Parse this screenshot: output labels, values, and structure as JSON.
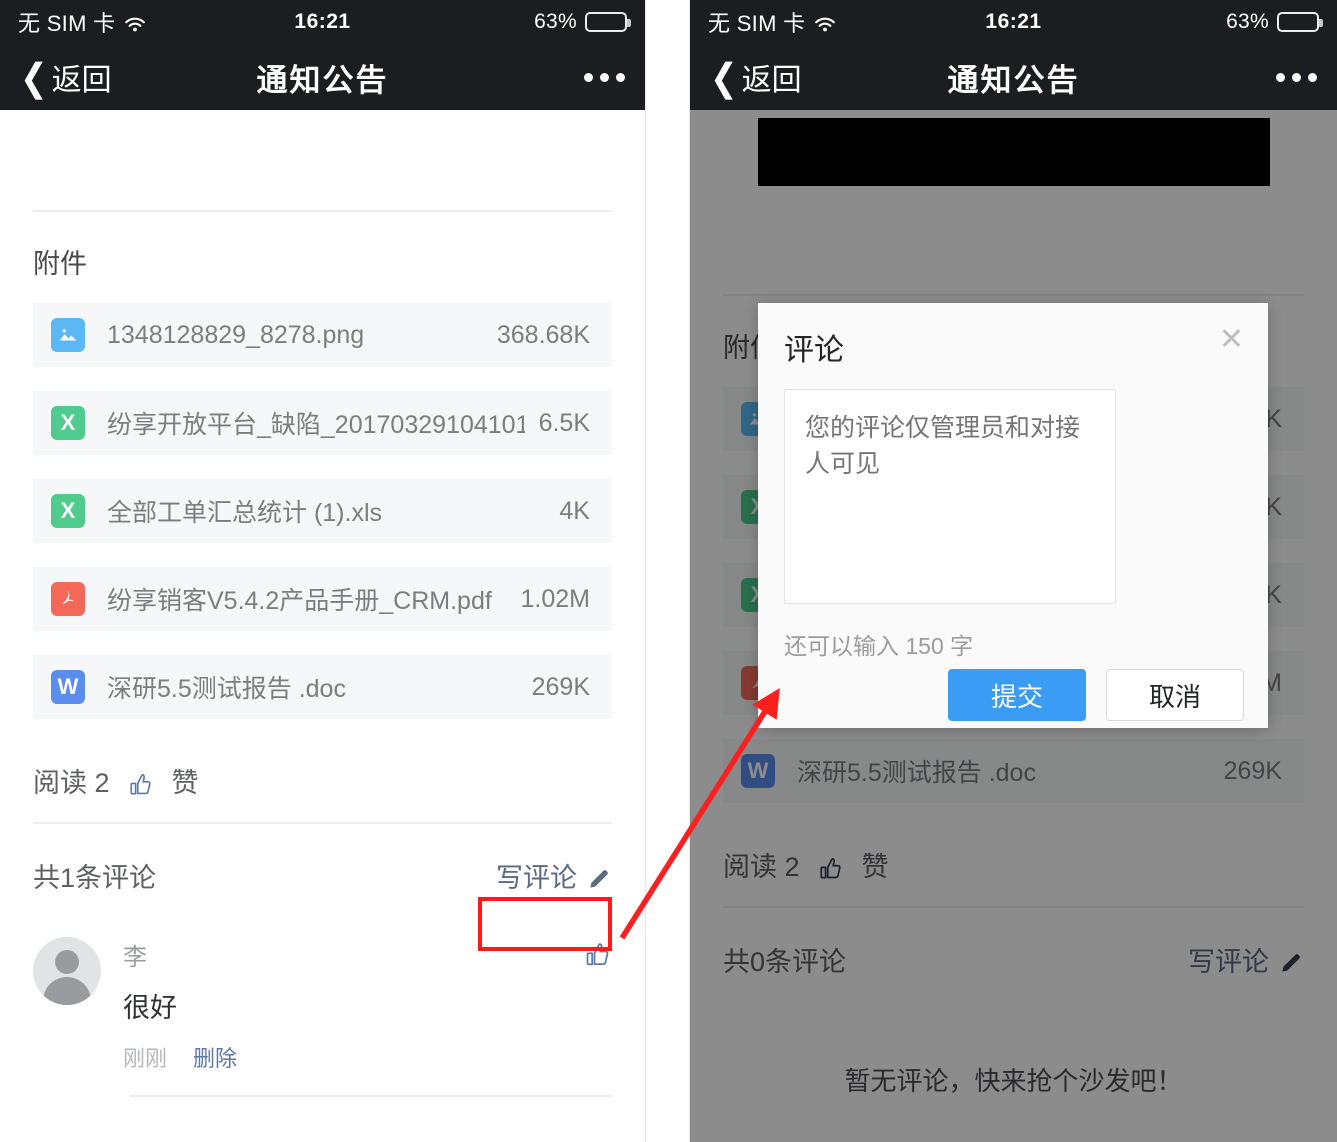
{
  "status_bar": {
    "carrier": "无 SIM 卡",
    "wifi_icon": "wifi-icon",
    "time": "16:21",
    "battery_percent": "63%",
    "battery_level": 63,
    "battery_icon": "battery-icon"
  },
  "nav_bar": {
    "back_chevron": "chevron-left-icon",
    "back_label": "返回",
    "title": "通知公告",
    "more_icon": "more-horizontal-icon"
  },
  "attachments": {
    "section_title": "附件",
    "files": [
      {
        "icon": "image-file-icon",
        "type": "png",
        "glyph": "",
        "color": "#5bb8f5",
        "name": "1348128829_8278.png",
        "size": "368.68K"
      },
      {
        "icon": "excel-file-icon",
        "type": "xls",
        "glyph": "X",
        "color": "#4ecb8d",
        "name": "纷享开放平台_缺陷_20170329104101....",
        "size": "6.5K"
      },
      {
        "icon": "excel-file-icon",
        "type": "xls",
        "glyph": "X",
        "color": "#4ecb8d",
        "name": "全部工单汇总统计 (1).xls",
        "size": "4K"
      },
      {
        "icon": "pdf-file-icon",
        "type": "pdf",
        "glyph": "",
        "color": "#f4685a",
        "name": "纷享销客V5.4.2产品手册_CRM.pdf",
        "size": "1.02M"
      },
      {
        "icon": "word-file-icon",
        "type": "doc",
        "glyph": "W",
        "color": "#5b8def",
        "name": "深研5.5测试报告 .doc",
        "size": "269K"
      }
    ]
  },
  "meta": {
    "read_label": "阅读 2",
    "like_icon": "thumbs-up-icon",
    "like_label": "赞"
  },
  "left_panel": {
    "comment_count_label": "共1条评论",
    "write_comment_label": "写评论",
    "write_comment_icon": "pencil-icon",
    "comments": [
      {
        "avatar": "avatar-placeholder",
        "author": "李",
        "text": "很好",
        "time": "刚刚",
        "delete_label": "删除",
        "like_icon": "thumbs-up-icon"
      }
    ]
  },
  "right_panel": {
    "comment_count_label": "共0条评论",
    "write_comment_label": "写评论",
    "write_comment_icon": "pencil-icon",
    "empty_text": "暂无评论，快来抢个沙发吧！"
  },
  "modal": {
    "title": "评论",
    "close_icon": "close-icon",
    "textarea_placeholder": "您的评论仅管理员和对接人可见",
    "textarea_value": "",
    "counter_text": "还可以输入 150 字",
    "submit_label": "提交",
    "cancel_label": "取消",
    "primary_color": "#3b9cf5"
  },
  "annotations": {
    "highlight_color": "#ff1a1a",
    "arrow_color": "#fb2020",
    "highlight_target": "write-comment-button",
    "arrow_target": "comment-modal"
  }
}
